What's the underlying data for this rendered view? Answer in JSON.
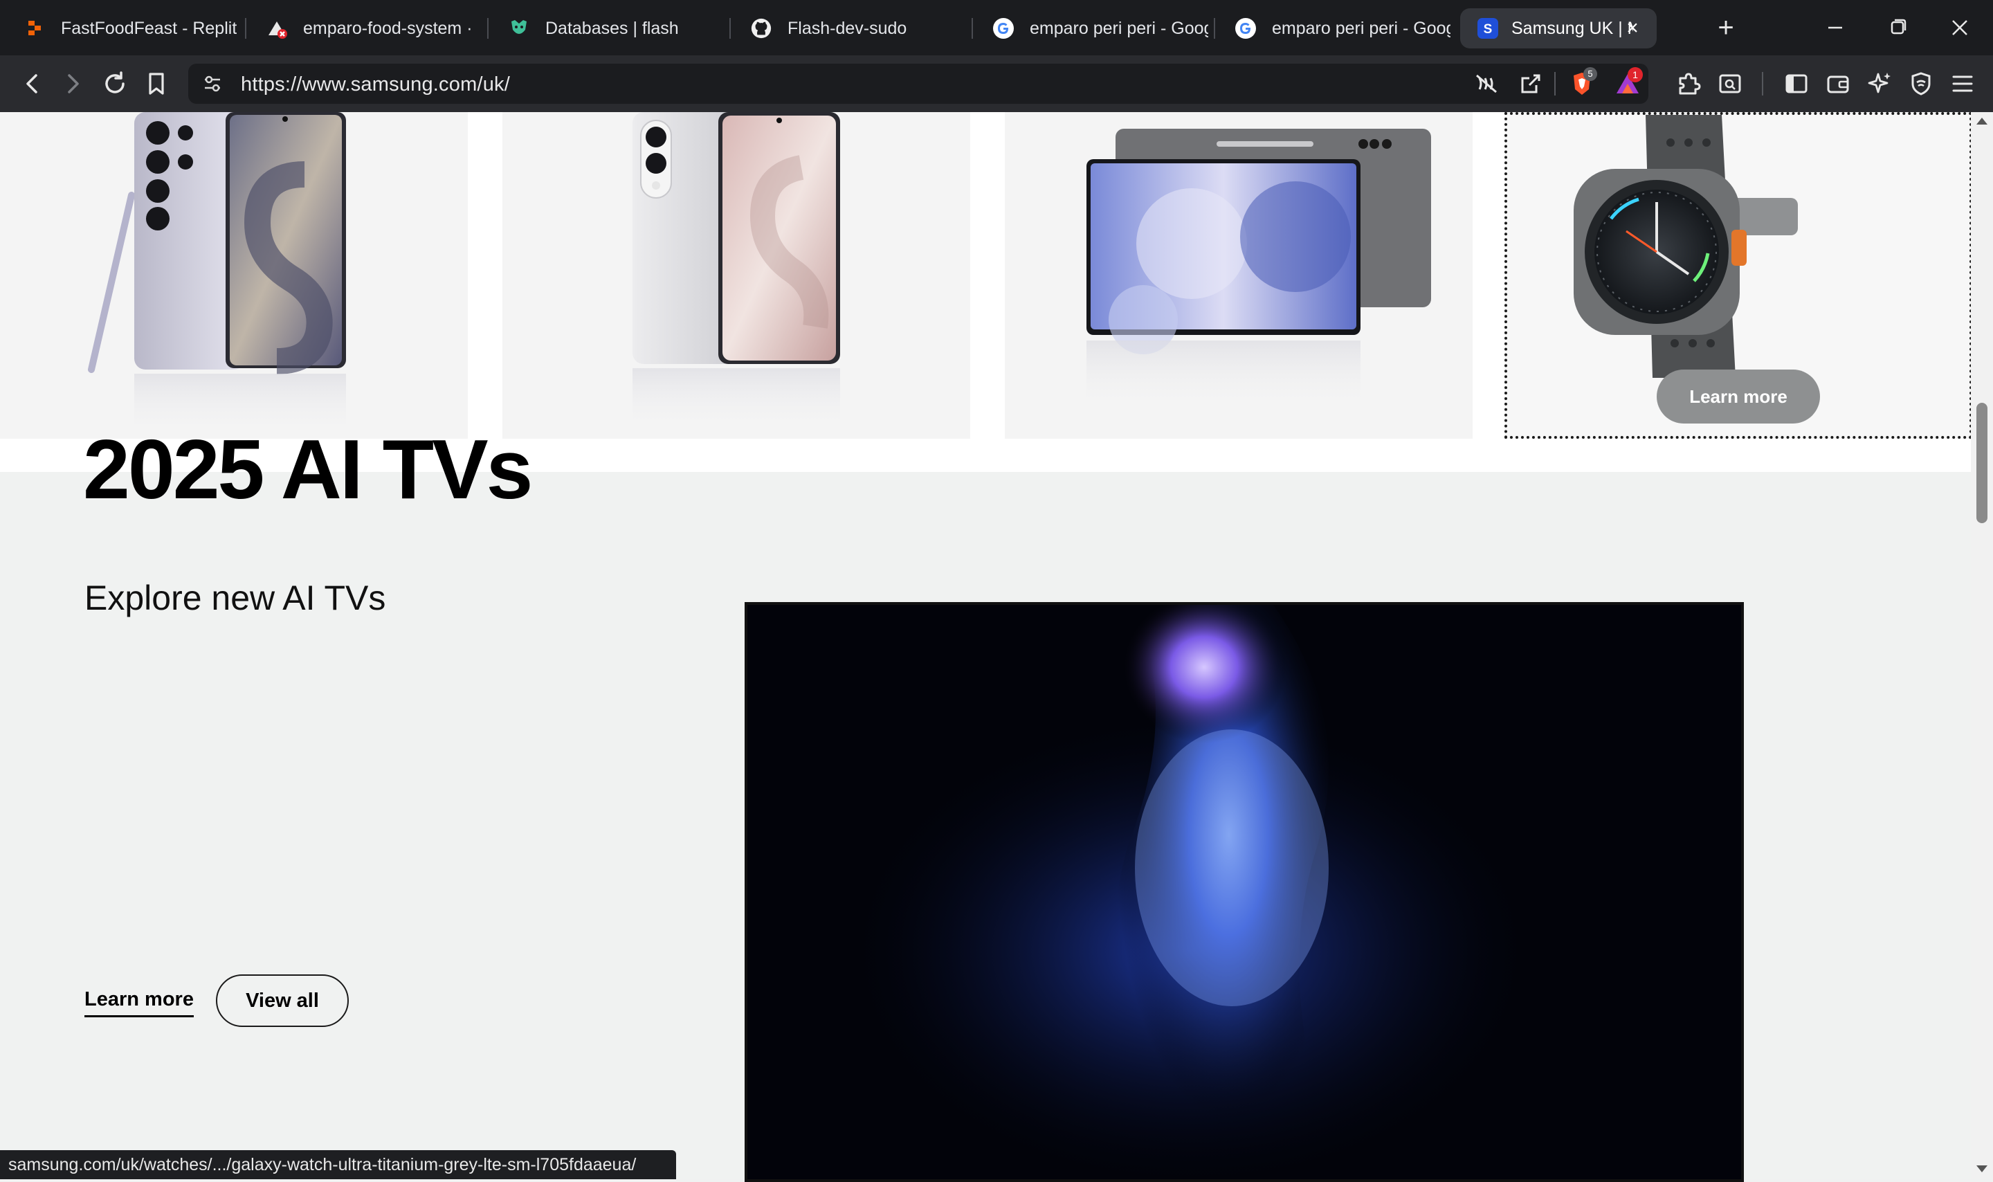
{
  "tabs": [
    {
      "label": "FastFoodFeast - Replit",
      "icon": "replit-icon"
    },
    {
      "label": "emparo-food-system ·",
      "icon": "vercel-error-icon"
    },
    {
      "label": "Databases | flash",
      "icon": "database-icon"
    },
    {
      "label": "Flash-dev-sudo",
      "icon": "github-icon"
    },
    {
      "label": "emparo peri peri - Goog",
      "icon": "google-icon"
    },
    {
      "label": "emparo peri peri - Goog",
      "icon": "google-icon"
    },
    {
      "label": "Samsung UK | Mob",
      "icon": "samsung-icon",
      "active": true
    }
  ],
  "address_bar": {
    "url": "https://www.samsung.com/uk/"
  },
  "toolbar_badges": {
    "brave_shields_count": "5",
    "rewards_count": "1"
  },
  "product_row": {
    "items": [
      {
        "name": "phone-with-s-pen"
      },
      {
        "name": "slim-phone"
      },
      {
        "name": "tablet"
      },
      {
        "name": "smartwatch",
        "cta": "Learn more"
      }
    ]
  },
  "tv_section": {
    "title": "2025 AI TVs",
    "subtitle": "Explore new AI TVs",
    "learn_more": "Learn more",
    "view_all": "View all"
  },
  "status_bar": {
    "link": "samsung.com/uk/watches/.../galaxy-watch-ultra-titanium-grey-lte-sm-l705fdaaeua/"
  },
  "colors": {
    "tabbar": "#1b1c1f",
    "toolbar": "#2a2b2f",
    "active_tab": "#34363b",
    "section_bg": "#f0f2f1"
  }
}
